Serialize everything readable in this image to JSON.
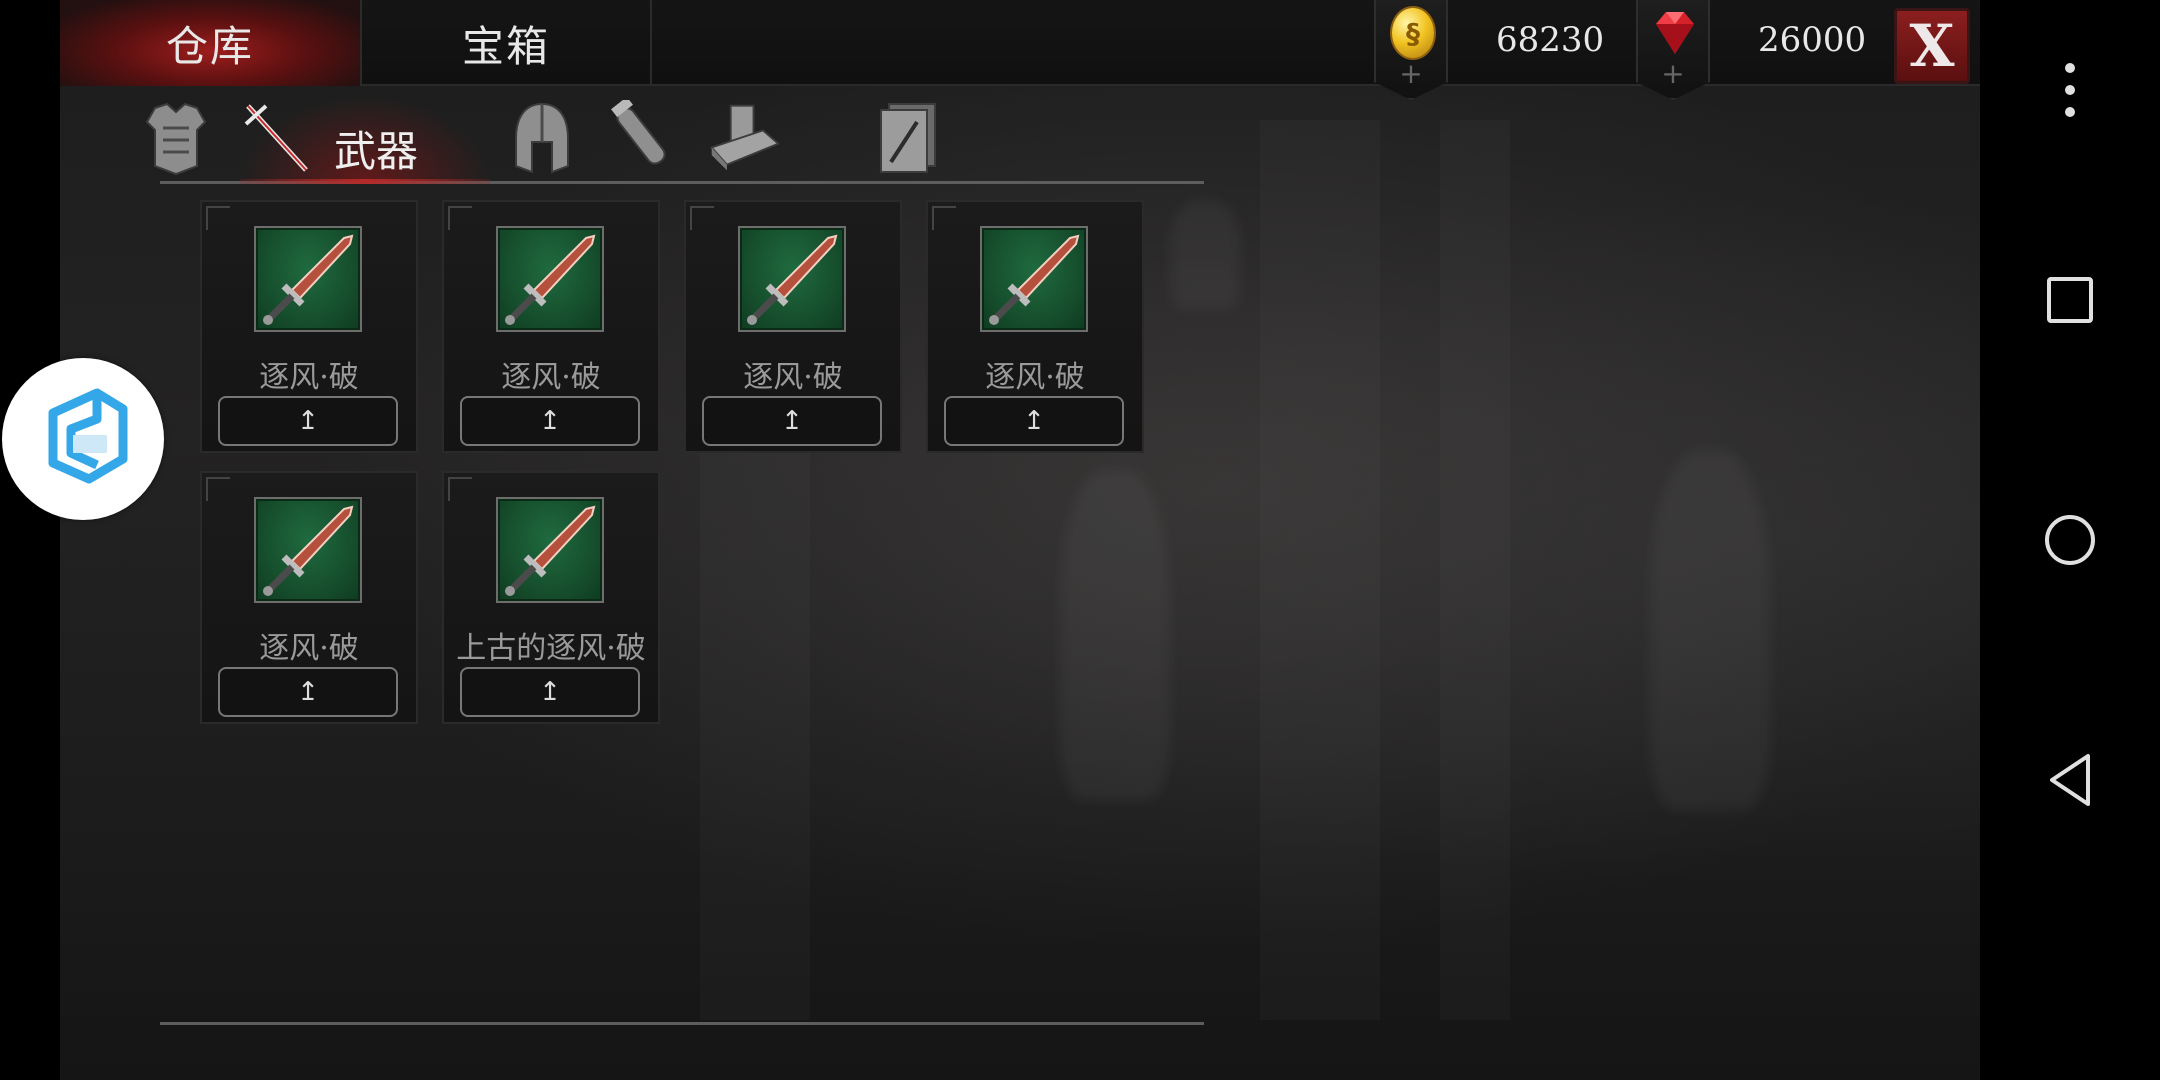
{
  "top_tabs": [
    {
      "label": "仓库",
      "active": true
    },
    {
      "label": "宝箱",
      "active": false
    }
  ],
  "currencies": {
    "gold": {
      "icon": "gold-coin-icon",
      "value": "68230",
      "add_icon": "plus-icon"
    },
    "gems": {
      "icon": "red-gem-icon",
      "value": "26000",
      "add_icon": "plus-icon"
    }
  },
  "close_label": "X",
  "categories": [
    {
      "icon": "armor-icon",
      "label": "",
      "active": false
    },
    {
      "icon": "sword-icon",
      "label": "武器",
      "active": true
    },
    {
      "icon": "helmet-icon",
      "label": "",
      "active": false
    },
    {
      "icon": "potion-icon",
      "label": "",
      "active": false
    },
    {
      "icon": "materials-icon",
      "label": "",
      "active": false
    },
    {
      "icon": "card-icon",
      "label": "",
      "active": false
    }
  ],
  "items": [
    {
      "name": "逐风·破",
      "icon": "sword-icon",
      "action": "↥"
    },
    {
      "name": "逐风·破",
      "icon": "sword-icon",
      "action": "↥"
    },
    {
      "name": "逐风·破",
      "icon": "sword-icon",
      "action": "↥"
    },
    {
      "name": "逐风·破",
      "icon": "sword-icon",
      "action": "↥"
    },
    {
      "name": "逐风·破",
      "icon": "sword-icon",
      "action": "↥"
    },
    {
      "name": "上古的逐风·破",
      "icon": "sword-icon",
      "action": "↥"
    }
  ],
  "colors": {
    "accent_red": "#9d1d1d",
    "thumb_green": "#1f6a3f",
    "gold": "#f2c322"
  },
  "system_nav": [
    "more-icon",
    "recents-icon",
    "home-icon",
    "back-icon"
  ]
}
